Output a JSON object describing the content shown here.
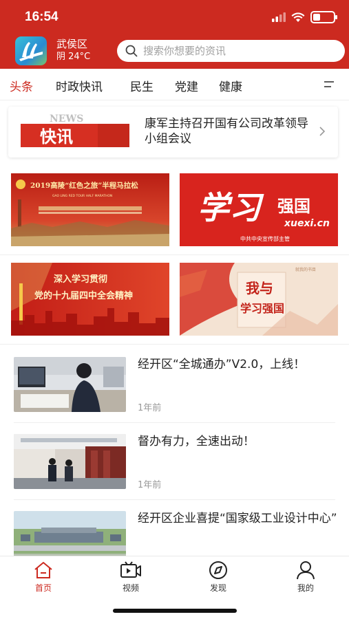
{
  "status_bar": {
    "time": "16:54",
    "battery_level": 0.35
  },
  "header": {
    "location": "武侯区",
    "weather": "阴 24°C",
    "search_placeholder": "搜索你想要的资讯",
    "accent_color": "#cc2a20"
  },
  "tabs": [
    {
      "label": "头条",
      "active": true
    },
    {
      "label": "时政快讯",
      "active": false
    },
    {
      "label": "民生",
      "active": false
    },
    {
      "label": "党建",
      "active": false
    },
    {
      "label": "健康",
      "active": false
    }
  ],
  "flash": {
    "logo_top": "NEWS",
    "logo_main": "快讯",
    "headline": "康军主持召开国有公司改革领导小组会议"
  },
  "banners": [
    {
      "title": "2019高陵“红色之旅”半程马拉松",
      "subtitle": "GAO LING RED TOUR HALF MARATHON"
    },
    {
      "title_left": "学习",
      "title_right": "强国",
      "domain": "xuexi.cn",
      "subtitle": "中共中央宣传部主管"
    },
    {
      "line1": "深入学习贯彻",
      "line2": "党的十九届四中全会精神"
    },
    {
      "line1": "我与",
      "line2": "学习强国",
      "tag": "就我的书目"
    }
  ],
  "news": [
    {
      "title": "经开区“全城通办”V2.0，上线！",
      "time": "1年前"
    },
    {
      "title": "督办有力，全速出动！",
      "time": "1年前"
    },
    {
      "title": "经开区企业喜提“国家级工业设计中心”",
      "time": ""
    }
  ],
  "bottom_nav": [
    {
      "label": "首页",
      "icon": "home-icon",
      "active": true
    },
    {
      "label": "视频",
      "icon": "video-icon",
      "active": false
    },
    {
      "label": "发现",
      "icon": "compass-icon",
      "active": false
    },
    {
      "label": "我的",
      "icon": "user-icon",
      "active": false
    }
  ]
}
